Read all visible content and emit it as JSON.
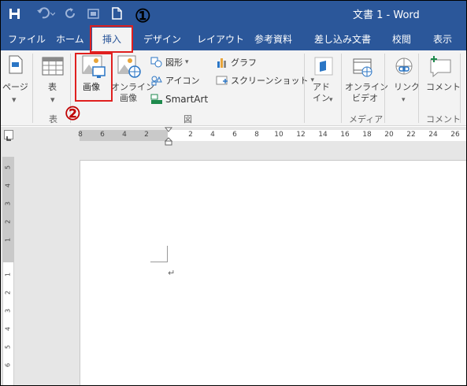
{
  "title_bar": {
    "doc_title": "文書 1  -  Word",
    "icons": [
      "save-icon",
      "undo-icon",
      "redo-icon",
      "touch-mode-icon",
      "new-document-icon"
    ]
  },
  "annotations": {
    "step1": "①",
    "step2": "②",
    "highlight_color": "#e0201f"
  },
  "tabs": [
    {
      "label": "ファイル"
    },
    {
      "label": "ホーム"
    },
    {
      "label": "挿入",
      "active": true
    },
    {
      "label": "デザイン"
    },
    {
      "label": "レイアウト"
    },
    {
      "label": "参考資料"
    },
    {
      "label": "差し込み文書"
    },
    {
      "label": "校閲"
    },
    {
      "label": "表示"
    }
  ],
  "ribbon": {
    "pages_label": "ページ",
    "table_label": "表",
    "pictures_label": "画像",
    "online_pictures_label1": "オンライン",
    "online_pictures_label2": "画像",
    "shapes_label": "図形",
    "icons_label": "アイコン",
    "smartart_label": "SmartArt",
    "chart_label": "グラフ",
    "screenshot_label": "スクリーンショット",
    "addins_label1": "アド",
    "addins_label2": "イン",
    "online_video_label1": "オンライン",
    "online_video_label2": "ビデオ",
    "links_label": "リンク",
    "comment_label": "コメント",
    "groups": {
      "tables": "表",
      "illustrations": "図",
      "media": "メディア",
      "comments": "コメント"
    }
  },
  "ruler": {
    "h_numbers": [
      "8",
      "6",
      "4",
      "2",
      "2",
      "4",
      "6",
      "8",
      "10",
      "12",
      "14",
      "16",
      "18",
      "20",
      "22",
      "24",
      "26"
    ],
    "v_numbers": [
      "5",
      "4",
      "3",
      "2",
      "1",
      "1",
      "2",
      "3",
      "4",
      "5",
      "6"
    ]
  },
  "document": {
    "paragraph_mark": "↵"
  },
  "colors": {
    "accent": "#2b579a",
    "ribbon_bg": "#f3f3f3"
  }
}
